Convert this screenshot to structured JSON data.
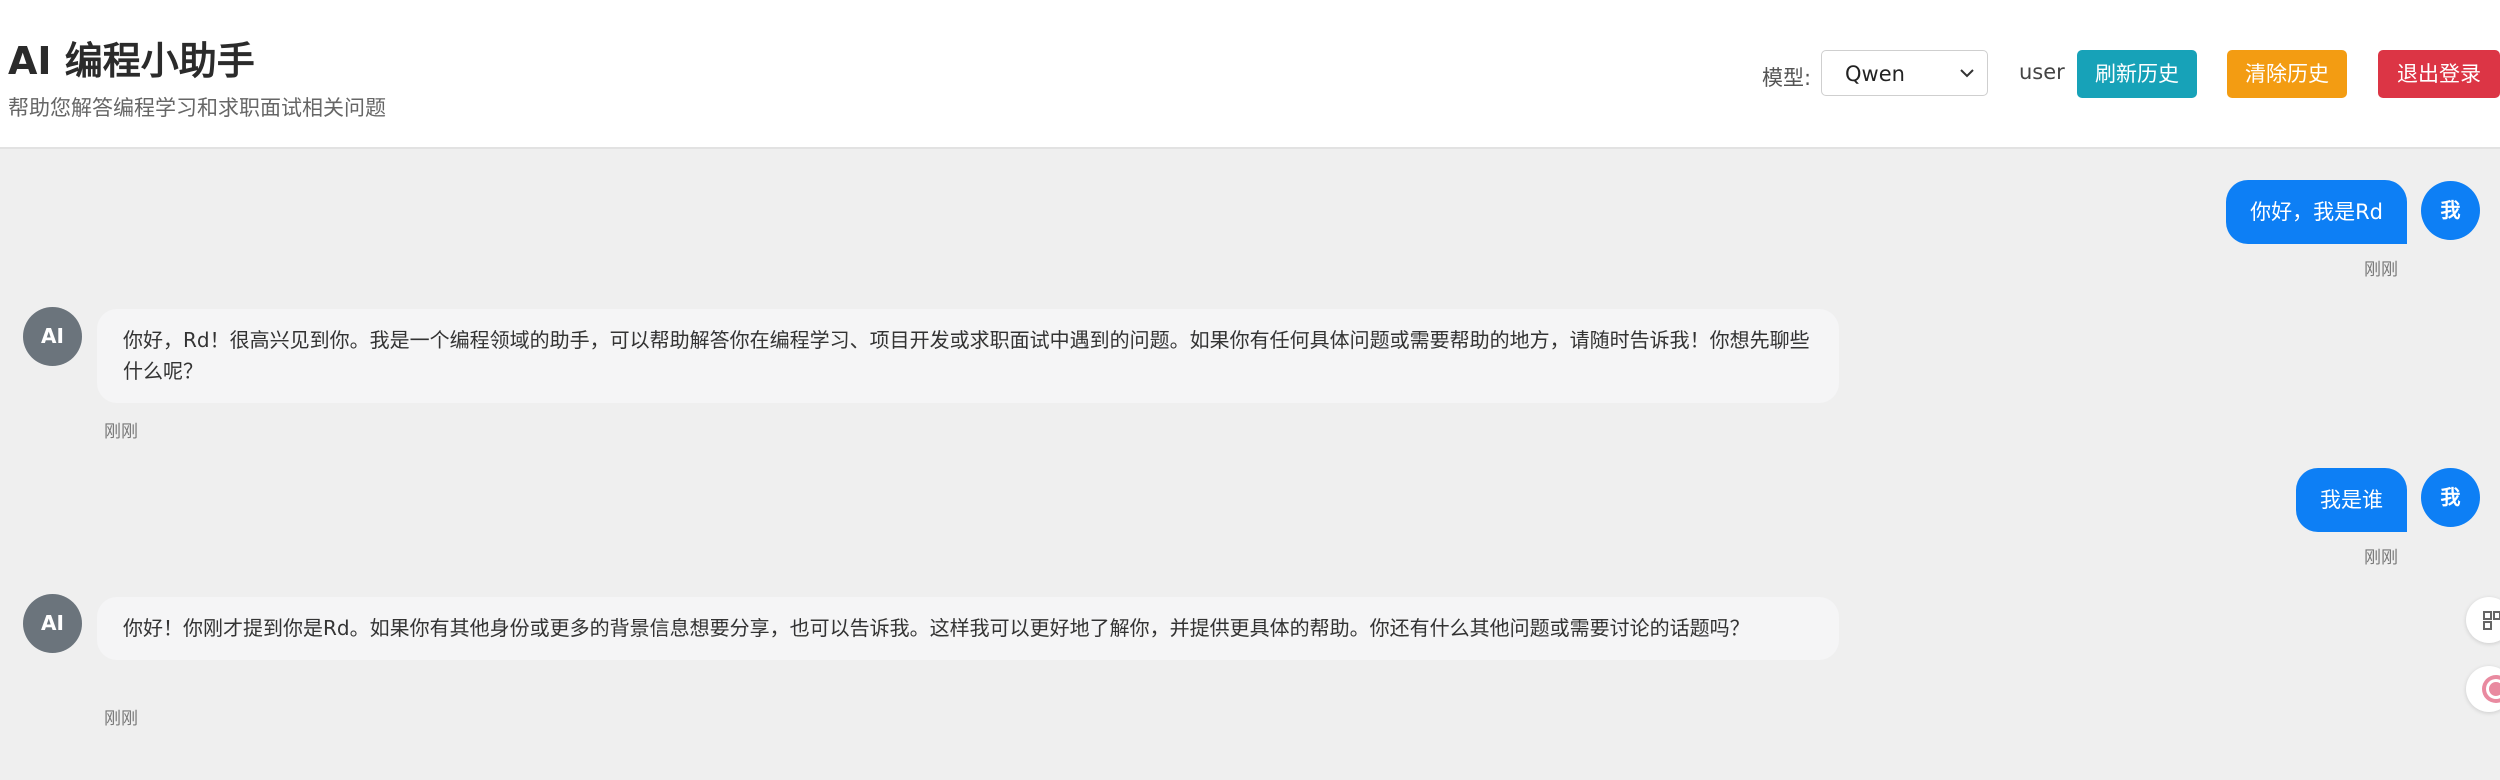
{
  "header": {
    "title": "AI 编程小助手",
    "subtitle": "帮助您解答编程学习和求职面试相关问题",
    "model_label": "模型:",
    "model_selected": "Qwen",
    "username": "user",
    "refresh_label": "刷新历史",
    "clear_label": "清除历史",
    "logout_label": "退出登录"
  },
  "messages": [
    {
      "role": "user",
      "avatar": "我",
      "text": "你好，我是Rd",
      "time": "刚刚"
    },
    {
      "role": "ai",
      "avatar": "AI",
      "text": "你好，Rd！很高兴见到你。我是一个编程领域的助手，可以帮助解答你在编程学习、项目开发或求职面试中遇到的问题。如果你有任何具体问题或需要帮助的地方，请随时告诉我！你想先聊些什么呢？",
      "time": "刚刚"
    },
    {
      "role": "user",
      "avatar": "我",
      "text": "我是谁",
      "time": "刚刚"
    },
    {
      "role": "ai",
      "avatar": "AI",
      "text": "你好！你刚才提到你是Rd。如果你有其他身份或更多的背景信息想要分享，也可以告诉我。这样我可以更好地了解你，并提供更具体的帮助。你还有什么其他问题或需要讨论的话题吗？",
      "time": "刚刚"
    }
  ],
  "icons": {
    "side_widget_1": "grid-icon",
    "side_widget_2": "translate-icon"
  },
  "colors": {
    "user_bubble": "#0d7ff5",
    "ai_avatar": "#6b747c",
    "refresh": "#17a2b8",
    "clear": "#f39c12",
    "logout": "#dc3545"
  }
}
